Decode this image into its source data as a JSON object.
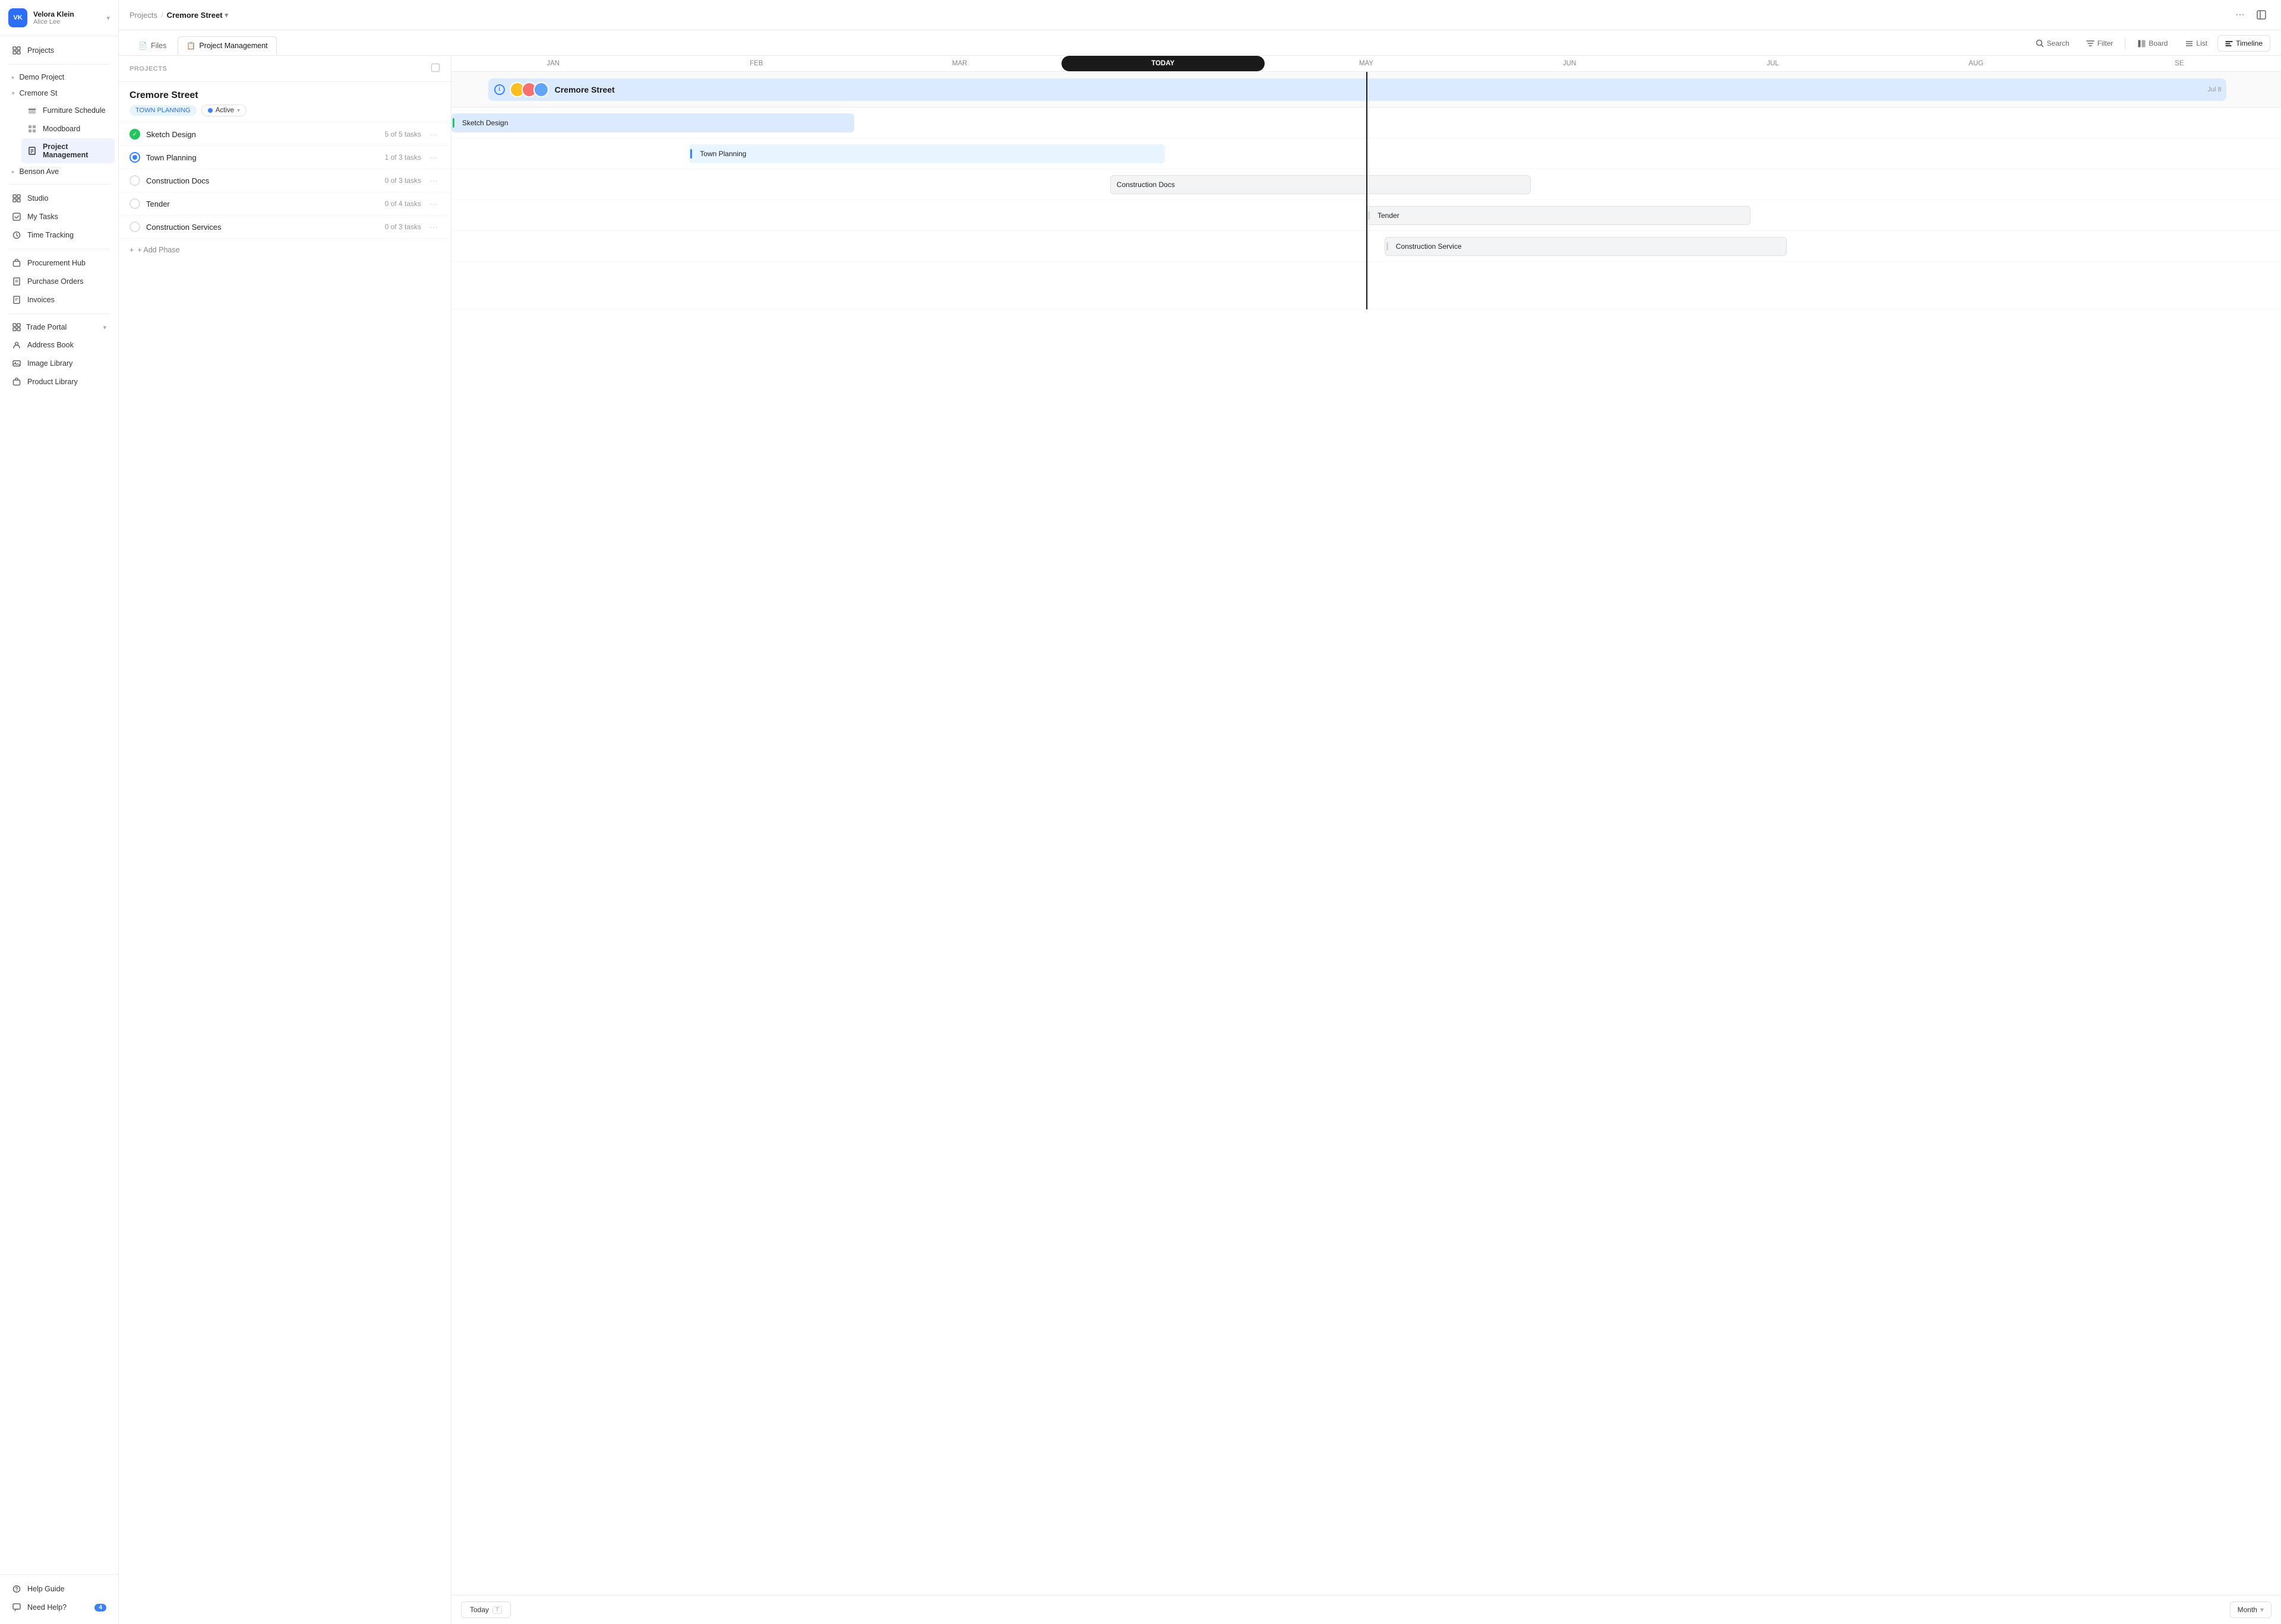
{
  "app": {
    "title": "Velora Klein"
  },
  "user": {
    "name": "Velora Klein",
    "subtitle": "Alice Lee",
    "initials": "VK"
  },
  "sidebar": {
    "top_items": [
      {
        "id": "projects",
        "label": "Projects",
        "icon": "grid"
      }
    ],
    "groups": [
      {
        "id": "demo-project",
        "label": "Demo Project",
        "expanded": false,
        "children": []
      },
      {
        "id": "cremore-st",
        "label": "Cremore St",
        "expanded": true,
        "children": [
          {
            "id": "furniture-schedule",
            "label": "Furniture Schedule",
            "icon": "stack"
          },
          {
            "id": "moodboard",
            "label": "Moodboard",
            "icon": "grid2"
          },
          {
            "id": "project-management",
            "label": "Project Management",
            "icon": "doc",
            "active": true
          }
        ]
      },
      {
        "id": "benson-ave",
        "label": "Benson Ave",
        "expanded": false,
        "children": []
      }
    ],
    "mid_items": [
      {
        "id": "studio",
        "label": "Studio",
        "icon": "grid"
      },
      {
        "id": "my-tasks",
        "label": "My Tasks",
        "icon": "check"
      },
      {
        "id": "time-tracking",
        "label": "Time Tracking",
        "icon": "clock"
      }
    ],
    "lower_items": [
      {
        "id": "procurement-hub",
        "label": "Procurement Hub",
        "icon": "bag"
      },
      {
        "id": "purchase-orders",
        "label": "Purchase Orders",
        "icon": "file"
      },
      {
        "id": "invoices",
        "label": "Invoices",
        "icon": "doc2"
      }
    ],
    "bottom_group": [
      {
        "id": "trade-portal",
        "label": "Trade Portal",
        "icon": "grid",
        "has_arrow": true
      },
      {
        "id": "address-book",
        "label": "Address Book",
        "icon": "person"
      },
      {
        "id": "image-library",
        "label": "Image Library",
        "icon": "image"
      },
      {
        "id": "product-library",
        "label": "Product Library",
        "icon": "box"
      }
    ],
    "footer_items": [
      {
        "id": "help-guide",
        "label": "Help Guide",
        "icon": "help"
      },
      {
        "id": "need-help",
        "label": "Need Help?",
        "icon": "chat",
        "badge": "4"
      }
    ]
  },
  "breadcrumb": {
    "parent": "Projects",
    "current": "Cremore Street"
  },
  "tabs": [
    {
      "id": "files",
      "label": "Files",
      "icon": "📄"
    },
    {
      "id": "project-management",
      "label": "Project Management",
      "icon": "📋",
      "active": true
    }
  ],
  "view_buttons": [
    {
      "id": "board",
      "label": "Board",
      "icon": "⊞"
    },
    {
      "id": "list",
      "label": "List",
      "icon": "≡"
    },
    {
      "id": "timeline",
      "label": "Timeline",
      "icon": "⊣",
      "active": true
    }
  ],
  "search_label": "Search",
  "filter_label": "Filter",
  "project_list_header": "PROJECTS",
  "project": {
    "name": "Cremore Street",
    "tag": "TOWN PLANNING",
    "status": "Active"
  },
  "phases": [
    {
      "id": "sketch-design",
      "name": "Sketch Design",
      "tasks": "5 of 5 tasks",
      "status": "done"
    },
    {
      "id": "town-planning",
      "name": "Town Planning",
      "tasks": "1 of 3 tasks",
      "status": "in-progress"
    },
    {
      "id": "construction-docs",
      "name": "Construction Docs",
      "tasks": "0 of 3 tasks",
      "status": "empty"
    },
    {
      "id": "tender",
      "name": "Tender",
      "tasks": "0 of 4 tasks",
      "status": "empty"
    },
    {
      "id": "construction-services",
      "name": "Construction Services",
      "tasks": "0 of 3 tasks",
      "status": "empty"
    }
  ],
  "add_phase_label": "+ Add Phase",
  "timeline": {
    "months": [
      "JAN",
      "FEB",
      "MAR",
      "TODAY",
      "MAY",
      "JUN",
      "JUL",
      "AUG",
      "SE"
    ],
    "today_label": "TODAY",
    "project_label": "Cremore Street",
    "project_date": "Jul 8",
    "bars": [
      {
        "id": "sketch-design",
        "label": "Sketch Design",
        "left": "0%",
        "width": "20%",
        "style": "blue-bar"
      },
      {
        "id": "town-planning",
        "label": "Town Planning",
        "left": "12%",
        "width": "25%",
        "style": "light-bar"
      },
      {
        "id": "construction-docs",
        "label": "Construction Docs",
        "left": "35%",
        "width": "22%",
        "style": "gray-bar"
      },
      {
        "id": "tender",
        "label": "Tender",
        "left": "50%",
        "width": "20%",
        "style": "gray-bar"
      },
      {
        "id": "construction-service",
        "label": "Construction Service",
        "left": "50%",
        "width": "21%",
        "style": "gray-bar"
      }
    ]
  },
  "footer": {
    "today_btn": "Today",
    "today_shortcut": "T",
    "month_label": "Month"
  }
}
